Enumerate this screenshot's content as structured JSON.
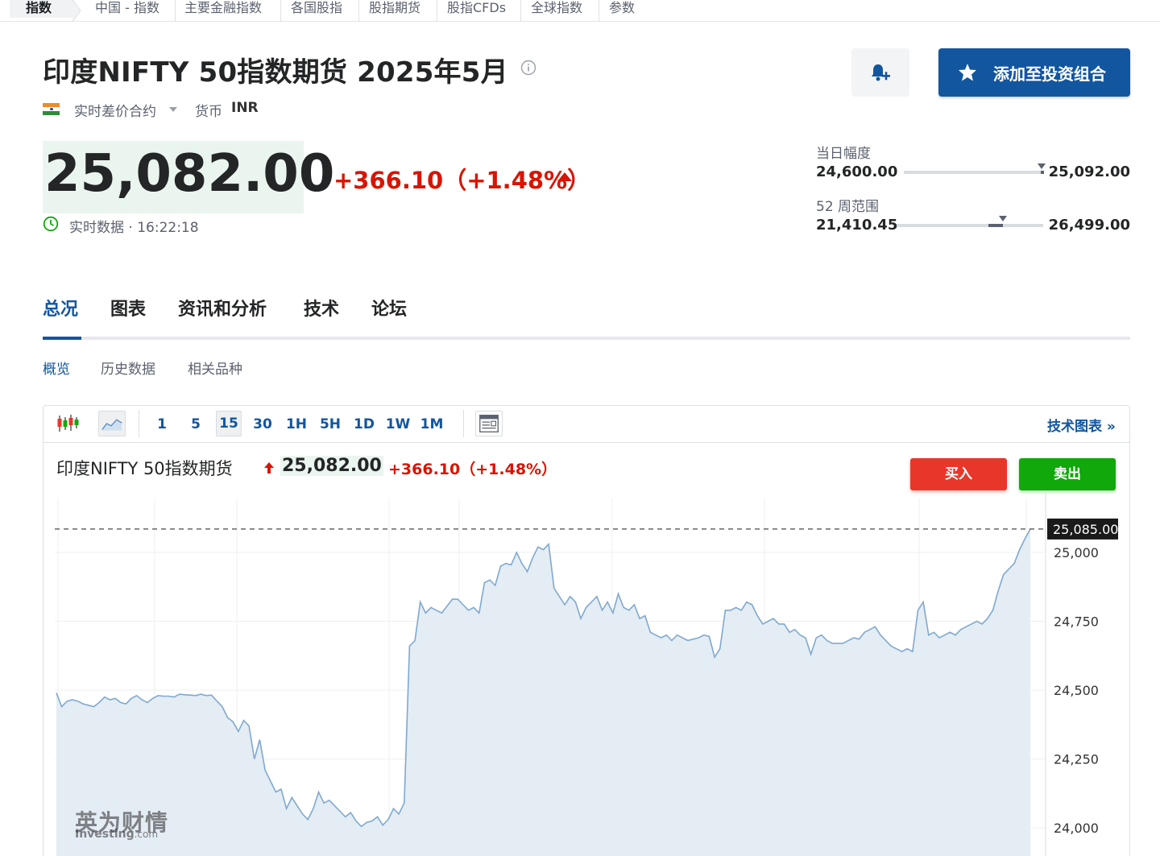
{
  "breadcrumb": [
    "指数",
    "中国 - 指数",
    "主要金融指数",
    "各国股指",
    "股指期货",
    "股指CFDs",
    "全球指数",
    "参数"
  ],
  "header": {
    "title": "印度NIFTY 50指数期货 2025年5月",
    "contract_type": "实时差价合约",
    "currency_label": "货币",
    "currency_value": "INR",
    "alert_icon": "bell-plus-icon",
    "portfolio_button": "添加至投资组合"
  },
  "quote": {
    "price": "25,082.00",
    "change": "+366.10（+1.48%）",
    "time_label": "实时数据 · 16:22:18",
    "direction": "up"
  },
  "ranges": {
    "day": {
      "label": "当日幅度",
      "low": "24,600.00",
      "high": "25,092.00",
      "position": 0.98
    },
    "week52": {
      "label": "52 周范围",
      "low": "21,410.45",
      "high": "26,499.00",
      "position": 0.72
    }
  },
  "tabs": [
    "总况",
    "图表",
    "资讯和分析",
    "技术",
    "论坛"
  ],
  "subtabs": [
    "概览",
    "历史数据",
    "相关品种"
  ],
  "chart_toolbar": {
    "timeframes": [
      "1",
      "5",
      "15",
      "30",
      "1H",
      "5H",
      "1D",
      "1W",
      "1M"
    ],
    "selected": "15",
    "tech_link": "技术图表 »"
  },
  "chart_header": {
    "name": "印度NIFTY 50指数期货",
    "price": "25,082.00",
    "change": "+366.10（+1.48%）",
    "buy": "买入",
    "sell": "卖出"
  },
  "colors": {
    "accent": "#1256a0",
    "up": "#d91400",
    "buy": "#e8372a",
    "sell": "#11a80c",
    "line": "#7fa9cf",
    "area": "#e4ecf4"
  },
  "watermark": {
    "cn": "英为财情",
    "en": "Investing",
    "domain": ".com"
  },
  "chart_data": {
    "type": "area",
    "ylim": [
      23900,
      25150
    ],
    "y_ticks": [
      25000,
      24750,
      24500,
      24250,
      24000
    ],
    "y_tick_labels": [
      "25,000",
      "24,750",
      "24,500",
      "24,250",
      "24,000"
    ],
    "last_value": 25085,
    "last_label": "25,085.00",
    "values": [
      24490,
      24440,
      24460,
      24465,
      24460,
      24450,
      24445,
      24440,
      24455,
      24475,
      24465,
      24470,
      24455,
      24450,
      24470,
      24480,
      24465,
      24455,
      24470,
      24480,
      24478,
      24478,
      24475,
      24485,
      24483,
      24482,
      24480,
      24485,
      24480,
      24482,
      24460,
      24440,
      24400,
      24385,
      24350,
      24390,
      24370,
      24250,
      24320,
      24210,
      24170,
      24130,
      24140,
      24070,
      24110,
      24080,
      24050,
      24030,
      24070,
      24130,
      24090,
      24100,
      24080,
      24060,
      24040,
      24055,
      24025,
      24005,
      24020,
      24025,
      24040,
      24010,
      24030,
      24070,
      24050,
      24090,
      24660,
      24680,
      24820,
      24780,
      24800,
      24790,
      24780,
      24805,
      24830,
      24830,
      24810,
      24790,
      24800,
      24780,
      24890,
      24900,
      24880,
      24950,
      24960,
      24955,
      25000,
      24960,
      24930,
      24980,
      25020,
      25010,
      25030,
      24870,
      24840,
      24810,
      24840,
      24820,
      24760,
      24800,
      24820,
      24840,
      24790,
      24820,
      24780,
      24850,
      24800,
      24790,
      24810,
      24760,
      24770,
      24710,
      24700,
      24690,
      24700,
      24680,
      24700,
      24690,
      24680,
      24685,
      24690,
      24700,
      24695,
      24620,
      24650,
      24790,
      24790,
      24800,
      24790,
      24820,
      24810,
      24770,
      24740,
      24750,
      24760,
      24740,
      24740,
      24710,
      24720,
      24700,
      24690,
      24630,
      24690,
      24700,
      24680,
      24670,
      24670,
      24670,
      24680,
      24690,
      24685,
      24710,
      24720,
      24730,
      24700,
      24680,
      24660,
      24650,
      24640,
      24650,
      24640,
      24790,
      24820,
      24700,
      24710,
      24690,
      24700,
      24710,
      24700,
      24720,
      24730,
      24740,
      24750,
      24740,
      24760,
      24790,
      24860,
      24920,
      24940,
      24960,
      25010,
      25050,
      25085
    ]
  }
}
